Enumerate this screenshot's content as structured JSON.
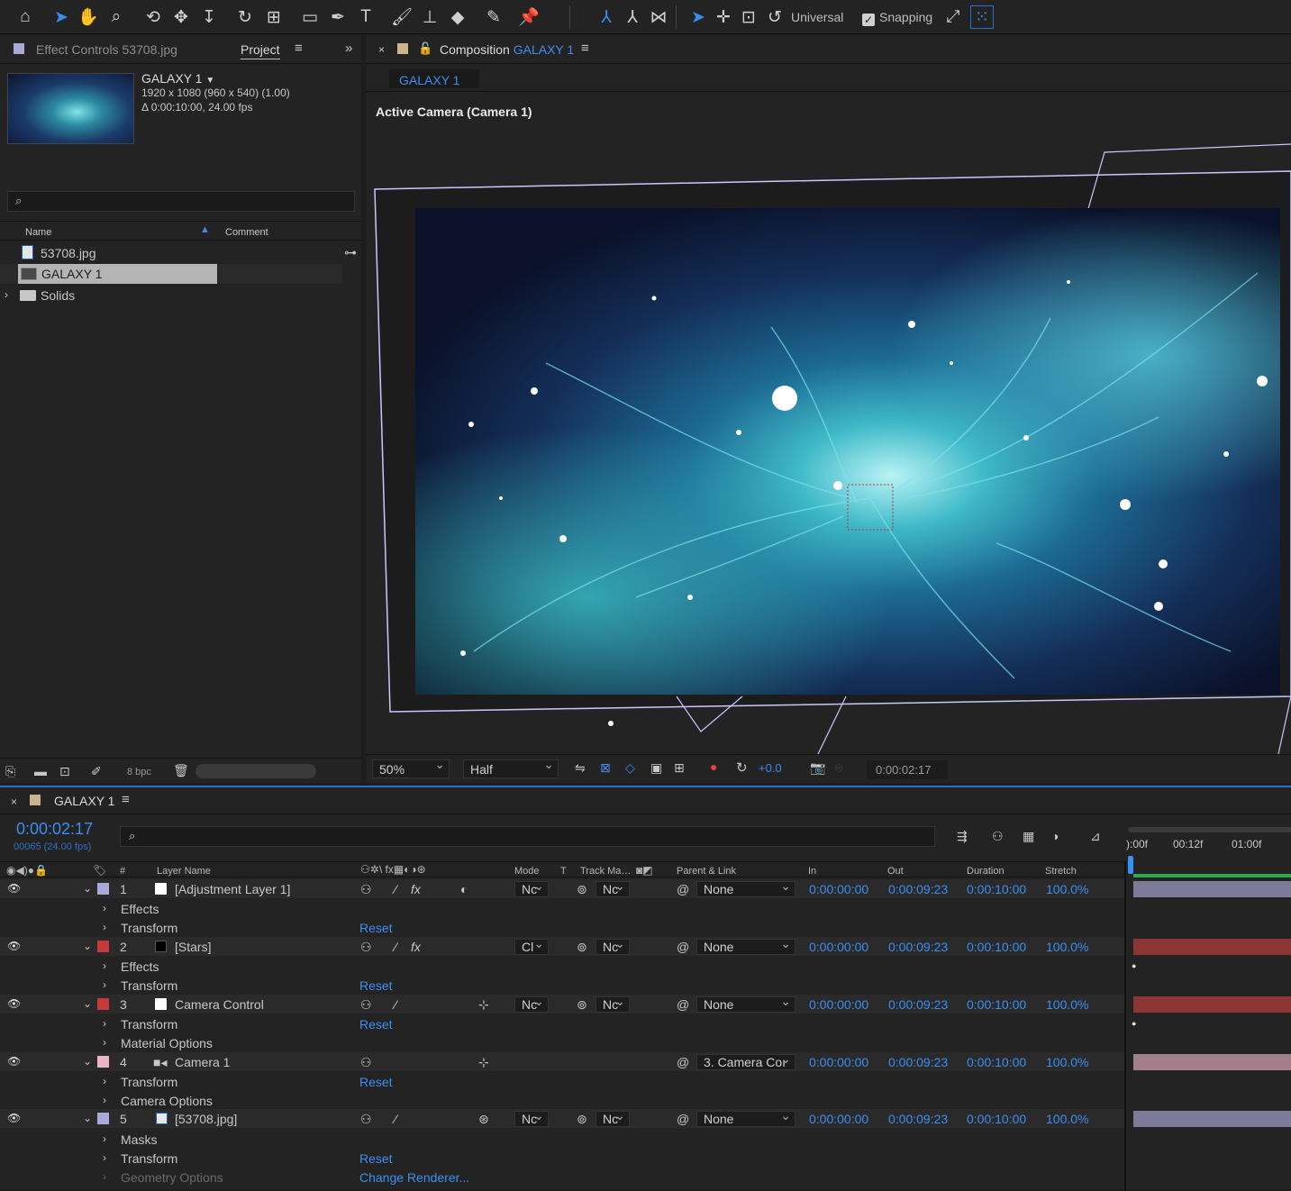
{
  "toolbar": {
    "universal_label": "Universal",
    "snapping_label": "Snapping",
    "snapping_checked": true,
    "icons": [
      "home-icon",
      "selection-icon",
      "hand-icon",
      "zoom-icon",
      "orbit-camera-icon",
      "pan-camera-icon",
      "dolly-camera-icon",
      "rotate-icon",
      "pan-behind-icon",
      "rectangle-icon",
      "pen-icon",
      "type-icon",
      "brush-icon",
      "clone-stamp-icon",
      "eraser-icon",
      "roto-brush-icon",
      "puppet-pin-icon",
      "local-axis-icon",
      "world-axis-icon",
      "view-axis-icon",
      "selection-3d-icon",
      "move-3d-icon",
      "scale-3d-icon",
      "rotate-3d-icon"
    ]
  },
  "project_panel": {
    "effect_controls_tab": "Effect Controls 53708.jpg",
    "project_tab": "Project",
    "comp_name": "GALAXY 1",
    "comp_size": "1920 x 1080  (960 x 540) (1.00)",
    "comp_duration": "Δ 0:00:10:00, 24.00 fps",
    "search_placeholder": "",
    "col_name": "Name",
    "col_comment": "Comment",
    "items": [
      {
        "label": "53708.jpg",
        "type": "image"
      },
      {
        "label": "GALAXY 1",
        "type": "composition",
        "selected": true
      },
      {
        "label": "Solids",
        "type": "folder"
      }
    ],
    "bpc_label": "8 bpc"
  },
  "comp_viewer": {
    "tab_prefix": "Composition",
    "tab_comp": "GALAXY 1",
    "subtab": "GALAXY 1",
    "view_label": "Active Camera (Camera 1)",
    "zoom": "50%",
    "resolution": "Half",
    "exposure": "+0.0",
    "timecode": "0:00:02:17"
  },
  "timeline": {
    "tab_label": "GALAXY 1",
    "current_time": "0:00:02:17",
    "frame_info": "00065 (24.00 fps)",
    "search_placeholder": "",
    "columns": {
      "num": "#",
      "layer_name": "Layer Name",
      "mode": "Mode",
      "t": "T",
      "track_matte": "Track Ma…",
      "parent": "Parent & Link",
      "in": "In",
      "out": "Out",
      "duration": "Duration",
      "stretch": "Stretch"
    },
    "ruler": [
      "):00f",
      "00:12f",
      "01:00f"
    ],
    "layers": [
      {
        "num": "1",
        "name": "[Adjustment Layer 1]",
        "color": "#a9a9d8",
        "src_color": "#ffffff",
        "mode": "Nc",
        "matte": "Nc",
        "parent": "None",
        "in": "0:00:00:00",
        "out": "0:00:09:23",
        "duration": "0:00:10:00",
        "stretch": "100.0%",
        "bar_color": "#7e7a99",
        "children": [
          {
            "label": "Effects"
          },
          {
            "label": "Transform",
            "action": "Reset"
          }
        ]
      },
      {
        "num": "2",
        "name": "[Stars]",
        "color": "#c23a3a",
        "src_color": "#000000",
        "mode": "Cl",
        "matte": "Nc",
        "parent": "None",
        "in": "0:00:00:00",
        "out": "0:00:09:23",
        "duration": "0:00:10:00",
        "stretch": "100.0%",
        "bar_color": "#8c3636",
        "children": [
          {
            "label": "Effects"
          },
          {
            "label": "Transform",
            "action": "Reset"
          }
        ]
      },
      {
        "num": "3",
        "name": "Camera Control",
        "color": "#c23a3a",
        "src_color": "#ffffff",
        "mode": "Nc",
        "matte": "Nc",
        "parent": "None",
        "in": "0:00:00:00",
        "out": "0:00:09:23",
        "duration": "0:00:10:00",
        "stretch": "100.0%",
        "bar_color": "#8c3636",
        "children": [
          {
            "label": "Transform",
            "action": "Reset"
          },
          {
            "label": "Material Options"
          }
        ]
      },
      {
        "num": "4",
        "name": "Camera 1",
        "color": "#e8b7c3",
        "src_color": "",
        "mode": "",
        "matte": "",
        "parent": "3. Camera Coı",
        "in": "0:00:00:00",
        "out": "0:00:09:23",
        "duration": "0:00:10:00",
        "stretch": "100.0%",
        "bar_color": "#a27f8a",
        "children": [
          {
            "label": "Transform",
            "action": "Reset"
          },
          {
            "label": "Camera Options"
          }
        ]
      },
      {
        "num": "5",
        "name": "[53708.jpg]",
        "color": "#a9a9d8",
        "src_color": "",
        "mode": "Nc",
        "matte": "Nc",
        "parent": "None",
        "in": "0:00:00:00",
        "out": "0:00:09:23",
        "duration": "0:00:10:00",
        "stretch": "100.0%",
        "bar_color": "#7e7a99",
        "children": [
          {
            "label": "Masks"
          },
          {
            "label": "Transform",
            "action": "Reset"
          },
          {
            "label": "Geometry Options",
            "action": "Change Renderer...",
            "dim": true
          }
        ]
      }
    ]
  }
}
